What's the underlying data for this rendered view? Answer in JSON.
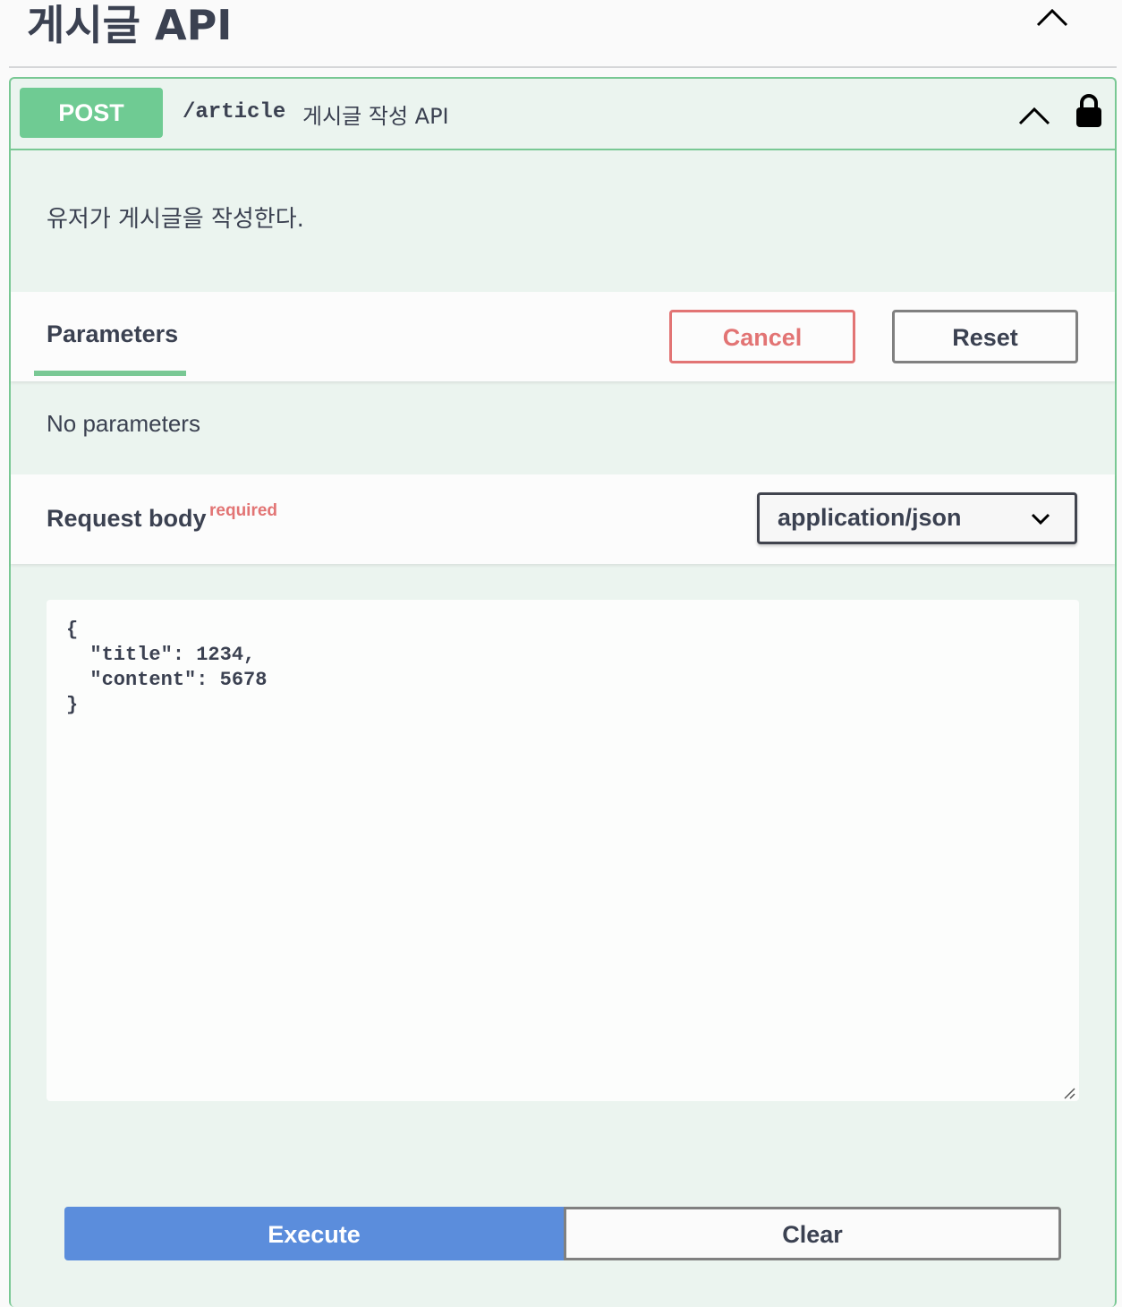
{
  "tag": {
    "title": "게시글 API"
  },
  "operation": {
    "method": "POST",
    "path": "/article",
    "summary": "게시글 작성 API",
    "description": "유저가 게시글을 작성한다."
  },
  "parameters": {
    "tab_label": "Parameters",
    "cancel_label": "Cancel",
    "reset_label": "Reset",
    "empty_text": "No parameters"
  },
  "request_body": {
    "label": "Request body",
    "required_label": "required",
    "content_type": "application/json",
    "editor_value": "{\n  \"title\": 1234,\n  \"content\": 5678\n}"
  },
  "actions": {
    "execute_label": "Execute",
    "clear_label": "Clear"
  },
  "colors": {
    "post_green": "#49cc90",
    "method_badge": "#6fcb93",
    "cancel_red": "#e27474",
    "execute_blue": "#5b8ddc"
  }
}
